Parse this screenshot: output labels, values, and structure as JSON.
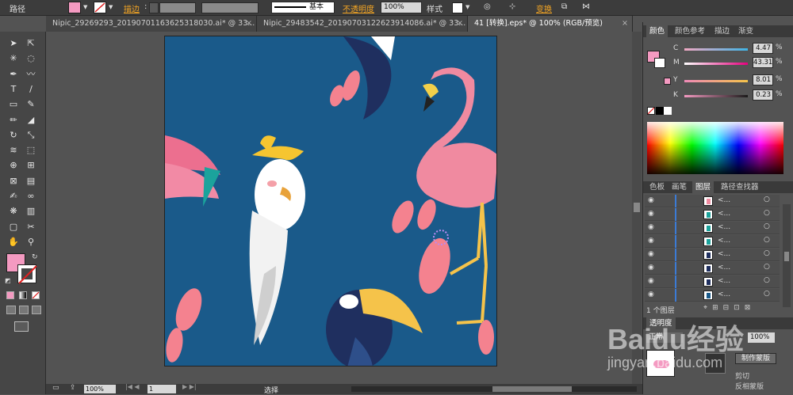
{
  "control_bar": {
    "path_label": "路径",
    "stroke_label": "描边",
    "stroke_style": "基本",
    "opacity_label": "不透明度",
    "opacity_value": "100%",
    "style_label": "样式",
    "transform_label": "变换",
    "fill_color": "#f49ac1"
  },
  "tabs": [
    {
      "label": "Nipic_29269293_20190701163625318030.ai* @ 33...",
      "close": "×"
    },
    {
      "label": "Nipic_29483542_20190703122623914086.ai* @ 33...",
      "close": "×"
    },
    {
      "label": "41 [转换].eps* @ 100% (RGB/预览)",
      "close": "×"
    }
  ],
  "toolbox": {
    "tools": [
      "selection-tool",
      "direct-selection-tool",
      "magic-wand-tool",
      "lasso-tool",
      "pen-tool",
      "curvature-tool",
      "type-tool",
      "line-tool",
      "rectangle-tool",
      "paintbrush-tool",
      "pencil-tool",
      "eraser-tool",
      "rotate-tool",
      "scale-tool",
      "width-tool",
      "free-transform-tool",
      "shape-builder-tool",
      "perspective-grid-tool",
      "mesh-tool",
      "gradient-tool",
      "eyedropper-tool",
      "blend-tool",
      "symbol-sprayer-tool",
      "column-graph-tool",
      "artboard-tool",
      "slice-tool",
      "hand-tool",
      "zoom-tool"
    ],
    "fill_color": "#f49ac1"
  },
  "color_panel": {
    "tabs": [
      "颜色",
      "颜色参考",
      "描边",
      "渐变"
    ],
    "sliders": [
      {
        "letter": "C",
        "value": "4.47",
        "gradient": "linear-gradient(90deg,#f2a9c4,#3fb4e6)"
      },
      {
        "letter": "M",
        "value": "43.31",
        "gradient": "linear-gradient(90deg,#ffffff,#e6007e)"
      },
      {
        "letter": "Y",
        "value": "8.01",
        "gradient": "linear-gradient(90deg,#f08ab8,#f5c34a)"
      },
      {
        "letter": "K",
        "value": "0.23",
        "gradient": "linear-gradient(90deg,#f49ac1,#1a1a1a)"
      }
    ],
    "percent": "%"
  },
  "layers_panel": {
    "tabs": [
      "色板",
      "画笔",
      "图层",
      "路径查找器"
    ],
    "rows": [
      "<...",
      "<...",
      "<...",
      "<...",
      "<...",
      "<...",
      "<...",
      "<..."
    ],
    "footer": "1 个图层"
  },
  "transparency_panel": {
    "tab": "透明度",
    "mode": "正常",
    "opacity": "100%",
    "make_mask": "制作蒙版",
    "clip": "剪切",
    "invert_mask": "反相蒙版"
  },
  "status_bar": {
    "zoom": "100%",
    "page": "1",
    "tool_status": "选择"
  },
  "watermark": {
    "text": "Baidu经验",
    "url": "jingyan.baidu.com"
  }
}
